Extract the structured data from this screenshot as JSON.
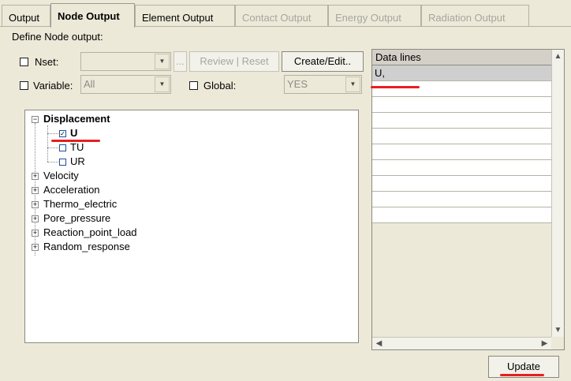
{
  "tabs": [
    {
      "label": "Output",
      "state": "normal"
    },
    {
      "label": "Node Output",
      "state": "active"
    },
    {
      "label": "Element Output",
      "state": "normal"
    },
    {
      "label": "Contact Output",
      "state": "disabled"
    },
    {
      "label": "Energy Output",
      "state": "disabled"
    },
    {
      "label": "Radiation Output",
      "state": "disabled"
    }
  ],
  "define_label": "Define Node output:",
  "nset": {
    "label": "Nset:",
    "value": "",
    "browse_label": "...",
    "review_label": "Review | Reset",
    "create_label": "Create/Edit.."
  },
  "variable": {
    "label": "Variable:",
    "value": "All"
  },
  "global": {
    "label": "Global:",
    "value": "YES"
  },
  "tree": {
    "root": {
      "label": "Displacement",
      "expanded": true,
      "children": [
        {
          "label": "U",
          "checked": true
        },
        {
          "label": "TU",
          "checked": false
        },
        {
          "label": "UR",
          "checked": false
        }
      ]
    },
    "collapsed": [
      "Velocity",
      "Acceleration",
      "Thermo_electric",
      "Pore_pressure",
      "Reaction_point_load",
      "Random_response"
    ]
  },
  "data_lines": {
    "header": "Data lines",
    "rows": [
      "U,",
      "",
      "",
      "",
      "",
      "",
      "",
      "",
      "",
      ""
    ]
  },
  "update_label": "Update",
  "colors": {
    "annotation": "#e52020",
    "selection": "#cfcfcf",
    "background": "#ece9d8"
  }
}
